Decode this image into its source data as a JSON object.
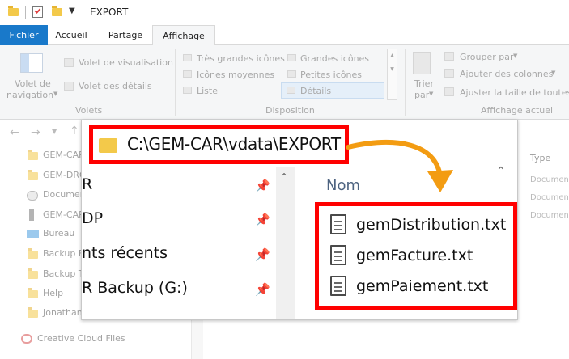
{
  "window": {
    "title": "EXPORT"
  },
  "ribbon": {
    "tabs": [
      {
        "label": "Fichier"
      },
      {
        "label": "Accueil"
      },
      {
        "label": "Partage"
      },
      {
        "label": "Affichage"
      }
    ],
    "panes": {
      "nav_line1": "Volet de",
      "nav_line2": "navigation",
      "preview": "Volet de visualisation",
      "details": "Volet des détails",
      "group": "Volets"
    },
    "layout": {
      "xl": "Très grandes icônes",
      "lg": "Grandes icônes",
      "md": "Icônes moyennes",
      "sm": "Petites icônes",
      "list": "Liste",
      "details": "Détails",
      "group": "Disposition"
    },
    "view": {
      "sort1": "Trier",
      "sort2": "par",
      "groupby": "Grouper par",
      "addcols": "Ajouter des colonnes",
      "fit": "Ajuster la taille de toutes l",
      "group": "Affichage actuel"
    }
  },
  "sidebar": {
    "items": [
      "GEM-CAR",
      "GEM-DRO",
      "Documen",
      "GEM-CAR",
      "Bureau",
      "Backup E",
      "Backup T",
      "Help",
      "Jonathan",
      "Creative Cloud Files"
    ]
  },
  "bg_columns": {
    "type": "Type",
    "rows": [
      "Documen",
      "Documen",
      "Documen"
    ]
  },
  "zoom": {
    "path": "C:\\GEM-CAR\\vdata\\EXPORT",
    "quick": [
      "R",
      "DP",
      "nts récents",
      "R Backup (G:)"
    ],
    "column_header": "Nom",
    "files": [
      "gemDistribution.txt",
      "gemFacture.txt",
      "gemPaiement.txt"
    ]
  },
  "colors": {
    "accent": "#1f6fc5",
    "highlight": "#ff0000",
    "arrow": "#f39c12"
  }
}
